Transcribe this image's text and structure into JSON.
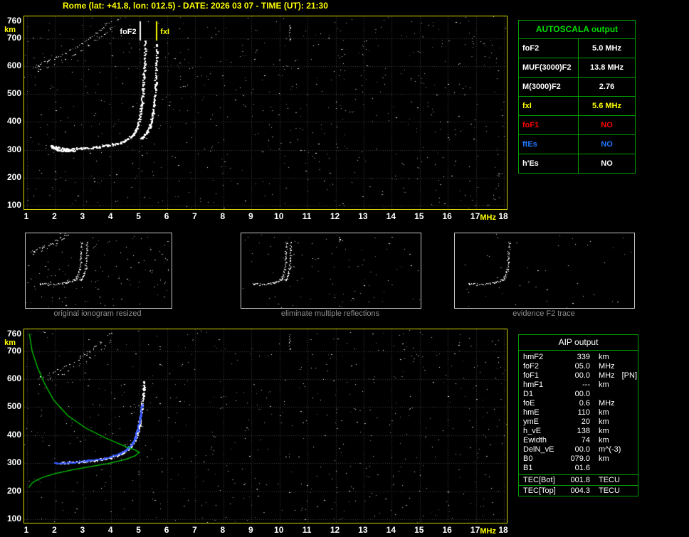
{
  "title": "Rome (lat: +41.8, lon: 012.5) - DATE: 2026 03 07 - TIME (UT): 21:30",
  "colors": {
    "accent_yellow": "#FFFF00",
    "accent_green": "#00A000",
    "grid": "#404040",
    "trace_white": "#FFFFFF",
    "trace_blue": "#3B5BFF",
    "profile_green": "#00CC00",
    "caption_gray": "#8F8F8F",
    "foF1_red": "#FF0000",
    "ftEs_blue": "#2277FF"
  },
  "top_plot": {
    "x_ticks": [
      "1",
      "2",
      "3",
      "4",
      "5",
      "6",
      "7",
      "8",
      "9",
      "10",
      "11",
      "12",
      "13",
      "14",
      "15",
      "16",
      "17",
      "18"
    ],
    "x_unit": "MHz",
    "y_ticks": [
      "760",
      "700",
      "600",
      "500",
      "400",
      "300",
      "200",
      "100"
    ],
    "y_unit": "km",
    "freq_range": [
      1,
      18
    ],
    "height_range": [
      100,
      760
    ],
    "markers": [
      {
        "label": "foF2",
        "freq": 5.0,
        "color": "#FFFFFF",
        "side": "left",
        "line": true
      },
      {
        "label": "fxI",
        "freq": 5.6,
        "color": "#FFFF00",
        "side": "right",
        "line": true
      }
    ],
    "noise": {
      "seed": 30,
      "count": 700
    },
    "traces": [
      {
        "name": "second_hop",
        "color": "#FFFFFF",
        "style": "dots",
        "size": 1,
        "dots": 85,
        "jitter": 1.6,
        "gap": 0.38,
        "seed": 11,
        "points": [
          [
            1.25,
            598
          ],
          [
            1.8,
            620
          ],
          [
            2.3,
            644
          ],
          [
            2.8,
            671
          ],
          [
            3.2,
            699
          ],
          [
            3.6,
            730
          ],
          [
            3.95,
            762
          ]
        ]
      },
      {
        "name": "second_hop_b",
        "color": "#FFFFFF",
        "style": "dots",
        "size": 1,
        "dots": 60,
        "jitter": 1.6,
        "gap": 0.5,
        "seed": 12,
        "points": [
          [
            1.35,
            583
          ],
          [
            1.9,
            604
          ],
          [
            2.4,
            627
          ],
          [
            2.9,
            653
          ],
          [
            3.3,
            681
          ],
          [
            3.7,
            711
          ],
          [
            4.05,
            744
          ]
        ]
      },
      {
        "name": "hook",
        "color": "#FFFFFF",
        "style": "dots",
        "size": 2,
        "dots": 45,
        "jitter": 1.3,
        "gap": 0.1,
        "seed": 15,
        "points": [
          [
            1.82,
            316
          ],
          [
            2.0,
            303
          ],
          [
            2.3,
            297
          ],
          [
            2.7,
            298
          ]
        ]
      },
      {
        "name": "main",
        "color": "#FFFFFF",
        "style": "dots",
        "size": 2,
        "dots": 250,
        "jitter": 1.3,
        "gap": 0.08,
        "seed": 13,
        "points": [
          [
            1.85,
            312
          ],
          [
            2.4,
            305
          ],
          [
            3.0,
            306
          ],
          [
            3.6,
            312
          ],
          [
            4.1,
            321
          ],
          [
            4.5,
            334
          ],
          [
            4.75,
            353
          ],
          [
            4.9,
            380
          ],
          [
            5.0,
            418
          ],
          [
            5.08,
            472
          ],
          [
            5.13,
            538
          ],
          [
            5.17,
            612
          ],
          [
            5.2,
            692
          ]
        ]
      },
      {
        "name": "x_branch",
        "color": "#FFFFFF",
        "style": "dots",
        "size": 2,
        "dots": 130,
        "jitter": 1.2,
        "gap": 0.12,
        "seed": 14,
        "points": [
          [
            5.05,
            342
          ],
          [
            5.25,
            362
          ],
          [
            5.38,
            392
          ],
          [
            5.47,
            432
          ],
          [
            5.53,
            482
          ],
          [
            5.57,
            546
          ],
          [
            5.6,
            616
          ],
          [
            5.62,
            682
          ]
        ]
      },
      {
        "name": "interference",
        "color": "#FFFFFF",
        "style": "dots",
        "size": 1,
        "dots": 16,
        "jitter": 0.7,
        "gap": 0.2,
        "seed": 16,
        "points": [
          [
            10.35,
            762
          ],
          [
            10.35,
            692
          ]
        ]
      }
    ]
  },
  "autoscala": {
    "header": "AUTOSCALA output",
    "rows": [
      {
        "label": "foF2",
        "value": "5.0 MHz",
        "color": "#FFFFFF"
      },
      {
        "label": "MUF(3000)F2",
        "value": "13.8 MHz",
        "color": "#FFFFFF"
      },
      {
        "label": "M(3000)F2",
        "value": "2.76",
        "color": "#FFFFFF"
      },
      {
        "label": "fxI",
        "value": "5.6 MHz",
        "color": "#FFFF00"
      },
      {
        "label": "foF1",
        "value": "NO",
        "color": "#FF0000"
      },
      {
        "label": "ftEs",
        "value": "NO",
        "color": "#2277FF"
      },
      {
        "label": "h'Es",
        "value": "NO",
        "color": "#FFFFFF"
      }
    ]
  },
  "thumbnails": [
    {
      "caption": "original ionogram resized",
      "freq_range": [
        1,
        12
      ],
      "noise": {
        "seed": 41,
        "count": 130
      },
      "trace_refs": [
        "second_hop",
        "second_hop_b",
        "main",
        "x_branch"
      ],
      "dot_scale": 0.5
    },
    {
      "caption": "eliminate multiple reflections",
      "freq_range": [
        1,
        18
      ],
      "noise": {
        "seed": 42,
        "count": 90
      },
      "trace_refs": [
        "main",
        "x_branch",
        "interference"
      ],
      "dot_scale": 0.5
    },
    {
      "caption": "evidence F2 trace",
      "freq_range": [
        1,
        15
      ],
      "noise": {
        "seed": 43,
        "count": 45
      },
      "trace_refs": [
        "main"
      ],
      "dot_scale": 0.5
    }
  ],
  "bottom_plot": {
    "x_ticks": [
      "1",
      "2",
      "3",
      "4",
      "5",
      "6",
      "7",
      "8",
      "9",
      "10",
      "11",
      "12",
      "13",
      "14",
      "15",
      "16",
      "17",
      "18"
    ],
    "x_unit": "MHz",
    "y_ticks": [
      "760",
      "700",
      "600",
      "500",
      "400",
      "300",
      "200",
      "100"
    ],
    "y_unit": "km",
    "freq_range": [
      1,
      18
    ],
    "height_range": [
      100,
      760
    ],
    "noise": {
      "seed": 31,
      "count": 600
    },
    "traces": [
      {
        "name": "second_hop",
        "color": "#FFFFFF",
        "style": "dots",
        "size": 1,
        "dots": 70,
        "jitter": 1.6,
        "gap": 0.45,
        "seed": 21,
        "points": [
          [
            1.25,
            598
          ],
          [
            1.8,
            620
          ],
          [
            2.3,
            644
          ],
          [
            2.8,
            671
          ],
          [
            3.2,
            699
          ],
          [
            3.6,
            730
          ],
          [
            3.95,
            762
          ]
        ]
      },
      {
        "name": "second_hop_b",
        "color": "#FFFFFF",
        "style": "dots",
        "size": 1,
        "dots": 45,
        "jitter": 1.6,
        "gap": 0.55,
        "seed": 26,
        "points": [
          [
            1.35,
            583
          ],
          [
            1.9,
            604
          ],
          [
            2.4,
            627
          ],
          [
            2.9,
            653
          ],
          [
            3.3,
            681
          ],
          [
            3.7,
            711
          ],
          [
            4.05,
            744
          ]
        ]
      },
      {
        "name": "f2_trace",
        "color": "#FFFFFF",
        "style": "dots",
        "size": 2,
        "dots": 210,
        "jitter": 1.3,
        "gap": 0.1,
        "seed": 22,
        "points": [
          [
            2.2,
            303
          ],
          [
            2.8,
            306
          ],
          [
            3.4,
            312
          ],
          [
            3.9,
            321
          ],
          [
            4.3,
            333
          ],
          [
            4.6,
            351
          ],
          [
            4.8,
            379
          ],
          [
            4.95,
            421
          ],
          [
            5.05,
            476
          ],
          [
            5.12,
            541
          ],
          [
            5.16,
            596
          ]
        ]
      },
      {
        "name": "fitted_trace",
        "color": "#3B5BFF",
        "style": "dots",
        "size": 2,
        "dots": 180,
        "jitter": 1.0,
        "gap": 0.08,
        "seed": 23,
        "points": [
          [
            1.95,
            301
          ],
          [
            2.5,
            304
          ],
          [
            3.1,
            309
          ],
          [
            3.7,
            318
          ],
          [
            4.2,
            331
          ],
          [
            4.55,
            350
          ],
          [
            4.78,
            377
          ],
          [
            4.92,
            416
          ],
          [
            5.02,
            466
          ],
          [
            5.08,
            512
          ]
        ]
      },
      {
        "name": "interference",
        "color": "#FFFFFF",
        "style": "dots",
        "size": 1,
        "dots": 14,
        "jitter": 0.7,
        "gap": 0.2,
        "seed": 24,
        "points": [
          [
            10.35,
            762
          ],
          [
            10.35,
            700
          ]
        ]
      },
      {
        "name": "density_profile",
        "color": "#00CC00",
        "style": "line",
        "width": 1.3,
        "points": [
          [
            1.08,
            762
          ],
          [
            1.18,
            700
          ],
          [
            1.38,
            640
          ],
          [
            1.62,
            585
          ],
          [
            1.95,
            525
          ],
          [
            2.45,
            470
          ],
          [
            3.1,
            425
          ],
          [
            3.8,
            390
          ],
          [
            4.45,
            362
          ],
          [
            4.85,
            347
          ],
          [
            5.0,
            339
          ],
          [
            4.85,
            326
          ],
          [
            4.5,
            313
          ],
          [
            3.9,
            299
          ],
          [
            3.2,
            287
          ],
          [
            2.55,
            275
          ],
          [
            2.0,
            263
          ],
          [
            1.6,
            251
          ],
          [
            1.35,
            240
          ],
          [
            1.18,
            229
          ],
          [
            1.06,
            213
          ]
        ]
      }
    ]
  },
  "aip": {
    "header": "AIP output",
    "rows": [
      {
        "name": "hmF2",
        "value": "339",
        "unit": "km"
      },
      {
        "name": "foF2",
        "value": "05.0",
        "unit": "MHz"
      },
      {
        "name": "foF1",
        "value": "00.0",
        "unit": "MHz",
        "note": "[PN]"
      },
      {
        "name": "hmF1",
        "value": "---",
        "unit": "km"
      },
      {
        "name": "D1",
        "value": "00.0",
        "unit": ""
      },
      {
        "name": "foE",
        "value": "0.6",
        "unit": "MHz"
      },
      {
        "name": "hmE",
        "value": "110",
        "unit": "km"
      },
      {
        "name": "ymE",
        "value": "20",
        "unit": "km"
      },
      {
        "name": "h_vE",
        "value": "138",
        "unit": "km"
      },
      {
        "name": "Ewidth",
        "value": "74",
        "unit": "km"
      },
      {
        "name": "DelN_vE",
        "value": "00.0",
        "unit": "m^(-3)"
      },
      {
        "name": "B0",
        "value": "079.0",
        "unit": "km"
      },
      {
        "name": "B1",
        "value": "01.6",
        "unit": ""
      }
    ],
    "tec_rows": [
      {
        "name": "TEC[Bot]",
        "value": "001.8",
        "unit": "TECU"
      },
      {
        "name": "TEC[Top]",
        "value": "004.3",
        "unit": "TECU"
      }
    ]
  }
}
